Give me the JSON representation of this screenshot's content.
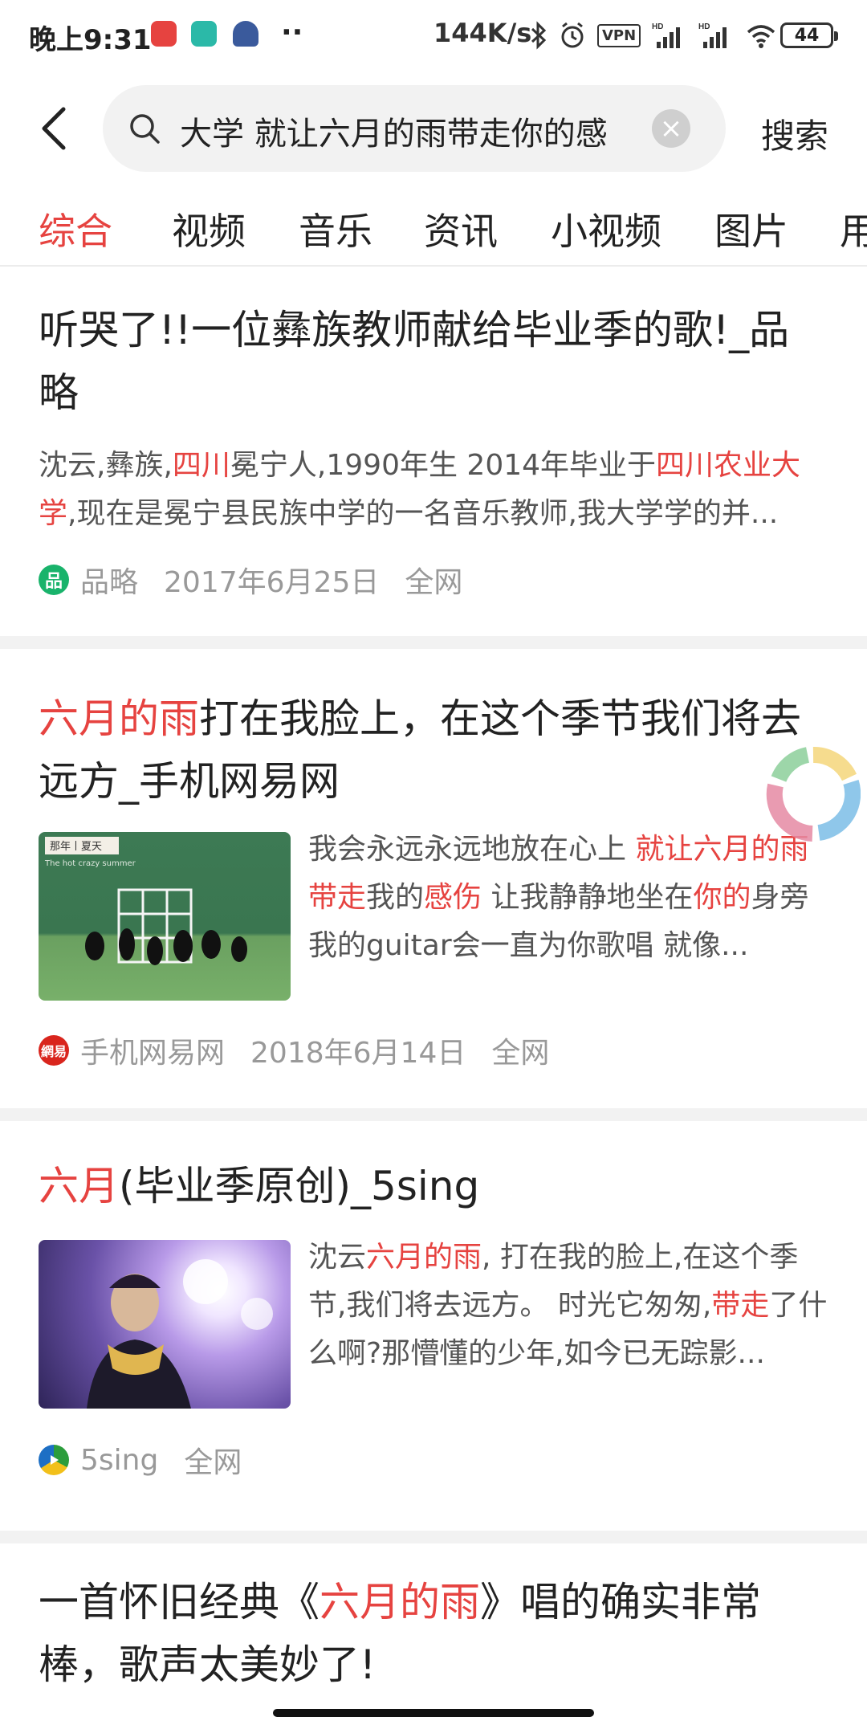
{
  "status": {
    "time": "晚上9:31",
    "speed": "144K/s",
    "vpn": "VPN",
    "battery": "44"
  },
  "search": {
    "query": "大学  就让六月的雨带走你的感",
    "search_button": "搜索"
  },
  "tabs": [
    "综合",
    "视频",
    "音乐",
    "资讯",
    "小视频",
    "图片",
    "用"
  ],
  "results": [
    {
      "title_plain": "听哭了!!一位彝族教师献给毕业季的歌!_品略",
      "desc": {
        "p1": "沈云,彝族,",
        "h1": "四川",
        "p2": "冕宁人,1990年生 2014年毕业于",
        "h2": "四川农业大学",
        "p3": ",现在是冕宁县民族中学的一名音乐教师,我大学学的并..."
      },
      "source": "品略",
      "date": "2017年6月25日",
      "scope": "全网"
    },
    {
      "title_hl": "六月的雨",
      "title_rest": "打在我脸上，在这个季节我们将去远方_手机网易网",
      "thumb_caption": "那年丨夏天",
      "thumb_small": "The hot crazy summer",
      "desc": {
        "p1": "我会永远永远地放在心上 ",
        "h1": "就让六月的雨带走",
        "p2": "我的",
        "h2": "感伤",
        "p3": " 让我静静地坐在",
        "h3": "你的",
        "p4": "身旁 我的guitar会一直为你歌唱 就像..."
      },
      "source": "手机网易网",
      "date": "2018年6月14日",
      "scope": "全网"
    },
    {
      "title_hl": "六月",
      "title_rest": "(毕业季原创)_5sing",
      "desc": {
        "p1": "沈云",
        "h1": "六月的雨",
        "p2": ", 打在我的脸上,在这个季节,我们将去远方。 时光它匆匆,",
        "h2": "带走",
        "p3": "了什么啊?那懵懂的少年,如今已无踪影..."
      },
      "source": "5sing",
      "scope": "全网"
    },
    {
      "title_p1": "一首怀旧经典《",
      "title_hl": "六月的雨",
      "title_p2": "》唱的确实非常棒，歌声太美妙了!"
    }
  ],
  "colors": {
    "accent": "#e64340",
    "text": "#222222",
    "meta": "#999999",
    "separator": "#f2f2f2"
  }
}
